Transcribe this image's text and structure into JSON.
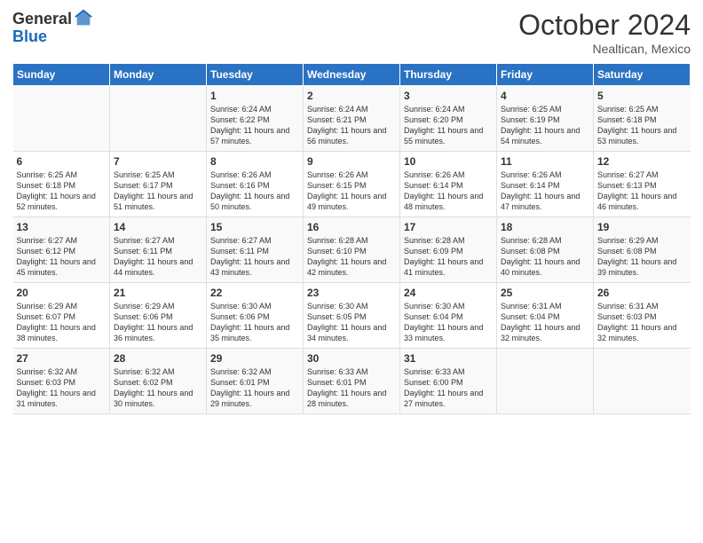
{
  "logo": {
    "general": "General",
    "blue": "Blue"
  },
  "header": {
    "month": "October 2024",
    "location": "Nealtican, Mexico"
  },
  "weekdays": [
    "Sunday",
    "Monday",
    "Tuesday",
    "Wednesday",
    "Thursday",
    "Friday",
    "Saturday"
  ],
  "weeks": [
    [
      {
        "day": "",
        "info": ""
      },
      {
        "day": "",
        "info": ""
      },
      {
        "day": "1",
        "info": "Sunrise: 6:24 AM\nSunset: 6:22 PM\nDaylight: 11 hours and 57 minutes."
      },
      {
        "day": "2",
        "info": "Sunrise: 6:24 AM\nSunset: 6:21 PM\nDaylight: 11 hours and 56 minutes."
      },
      {
        "day": "3",
        "info": "Sunrise: 6:24 AM\nSunset: 6:20 PM\nDaylight: 11 hours and 55 minutes."
      },
      {
        "day": "4",
        "info": "Sunrise: 6:25 AM\nSunset: 6:19 PM\nDaylight: 11 hours and 54 minutes."
      },
      {
        "day": "5",
        "info": "Sunrise: 6:25 AM\nSunset: 6:18 PM\nDaylight: 11 hours and 53 minutes."
      }
    ],
    [
      {
        "day": "6",
        "info": "Sunrise: 6:25 AM\nSunset: 6:18 PM\nDaylight: 11 hours and 52 minutes."
      },
      {
        "day": "7",
        "info": "Sunrise: 6:25 AM\nSunset: 6:17 PM\nDaylight: 11 hours and 51 minutes."
      },
      {
        "day": "8",
        "info": "Sunrise: 6:26 AM\nSunset: 6:16 PM\nDaylight: 11 hours and 50 minutes."
      },
      {
        "day": "9",
        "info": "Sunrise: 6:26 AM\nSunset: 6:15 PM\nDaylight: 11 hours and 49 minutes."
      },
      {
        "day": "10",
        "info": "Sunrise: 6:26 AM\nSunset: 6:14 PM\nDaylight: 11 hours and 48 minutes."
      },
      {
        "day": "11",
        "info": "Sunrise: 6:26 AM\nSunset: 6:14 PM\nDaylight: 11 hours and 47 minutes."
      },
      {
        "day": "12",
        "info": "Sunrise: 6:27 AM\nSunset: 6:13 PM\nDaylight: 11 hours and 46 minutes."
      }
    ],
    [
      {
        "day": "13",
        "info": "Sunrise: 6:27 AM\nSunset: 6:12 PM\nDaylight: 11 hours and 45 minutes."
      },
      {
        "day": "14",
        "info": "Sunrise: 6:27 AM\nSunset: 6:11 PM\nDaylight: 11 hours and 44 minutes."
      },
      {
        "day": "15",
        "info": "Sunrise: 6:27 AM\nSunset: 6:11 PM\nDaylight: 11 hours and 43 minutes."
      },
      {
        "day": "16",
        "info": "Sunrise: 6:28 AM\nSunset: 6:10 PM\nDaylight: 11 hours and 42 minutes."
      },
      {
        "day": "17",
        "info": "Sunrise: 6:28 AM\nSunset: 6:09 PM\nDaylight: 11 hours and 41 minutes."
      },
      {
        "day": "18",
        "info": "Sunrise: 6:28 AM\nSunset: 6:08 PM\nDaylight: 11 hours and 40 minutes."
      },
      {
        "day": "19",
        "info": "Sunrise: 6:29 AM\nSunset: 6:08 PM\nDaylight: 11 hours and 39 minutes."
      }
    ],
    [
      {
        "day": "20",
        "info": "Sunrise: 6:29 AM\nSunset: 6:07 PM\nDaylight: 11 hours and 38 minutes."
      },
      {
        "day": "21",
        "info": "Sunrise: 6:29 AM\nSunset: 6:06 PM\nDaylight: 11 hours and 36 minutes."
      },
      {
        "day": "22",
        "info": "Sunrise: 6:30 AM\nSunset: 6:06 PM\nDaylight: 11 hours and 35 minutes."
      },
      {
        "day": "23",
        "info": "Sunrise: 6:30 AM\nSunset: 6:05 PM\nDaylight: 11 hours and 34 minutes."
      },
      {
        "day": "24",
        "info": "Sunrise: 6:30 AM\nSunset: 6:04 PM\nDaylight: 11 hours and 33 minutes."
      },
      {
        "day": "25",
        "info": "Sunrise: 6:31 AM\nSunset: 6:04 PM\nDaylight: 11 hours and 32 minutes."
      },
      {
        "day": "26",
        "info": "Sunrise: 6:31 AM\nSunset: 6:03 PM\nDaylight: 11 hours and 32 minutes."
      }
    ],
    [
      {
        "day": "27",
        "info": "Sunrise: 6:32 AM\nSunset: 6:03 PM\nDaylight: 11 hours and 31 minutes."
      },
      {
        "day": "28",
        "info": "Sunrise: 6:32 AM\nSunset: 6:02 PM\nDaylight: 11 hours and 30 minutes."
      },
      {
        "day": "29",
        "info": "Sunrise: 6:32 AM\nSunset: 6:01 PM\nDaylight: 11 hours and 29 minutes."
      },
      {
        "day": "30",
        "info": "Sunrise: 6:33 AM\nSunset: 6:01 PM\nDaylight: 11 hours and 28 minutes."
      },
      {
        "day": "31",
        "info": "Sunrise: 6:33 AM\nSunset: 6:00 PM\nDaylight: 11 hours and 27 minutes."
      },
      {
        "day": "",
        "info": ""
      },
      {
        "day": "",
        "info": ""
      }
    ]
  ]
}
